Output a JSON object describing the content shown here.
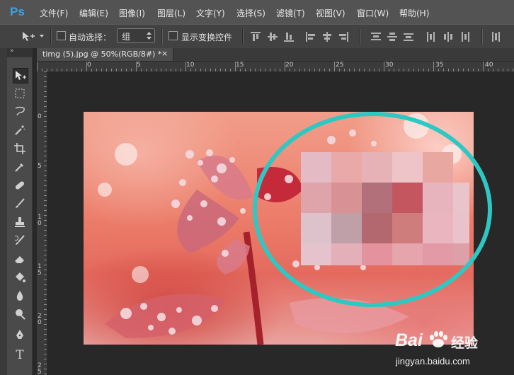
{
  "app": {
    "logo": "Ps"
  },
  "menu": [
    "文件(F)",
    "编辑(E)",
    "图像(I)",
    "图层(L)",
    "文字(Y)",
    "选择(S)",
    "滤镜(T)",
    "视图(V)",
    "窗口(W)",
    "帮助(H)"
  ],
  "options": {
    "auto_select_label": "自动选择：",
    "auto_select_value": "组",
    "show_transform_label": "显示变换控件"
  },
  "document": {
    "tab_title": "timg (5).jpg @ 50%(RGB/8#) *",
    "close_glyph": "×"
  },
  "ruler": {
    "top": [
      "0",
      "5",
      "10",
      "15",
      "20",
      "25",
      "30",
      "35",
      "40"
    ],
    "left": [
      "0",
      "5",
      "1\n0",
      "1\n5",
      "2\n0",
      "2\n5"
    ]
  },
  "toolbar": {
    "tools": [
      "move-tool",
      "marquee-tool",
      "lasso-tool",
      "magic-wand-tool",
      "crop-tool",
      "eyedropper-tool",
      "healing-brush-tool",
      "brush-tool",
      "clone-stamp-tool",
      "history-brush-tool",
      "eraser-tool",
      "paint-bucket-tool",
      "blur-tool",
      "dodge-tool",
      "pen-tool",
      "type-tool"
    ],
    "type_glyph": "T"
  },
  "watermark": {
    "brand": "Bai",
    "brand2": "经验",
    "url": "jingyan.baidu.com"
  },
  "colors": {
    "menubar_bg": "#535353",
    "highlight_circle": "#2ec8c4",
    "ps_blue": "#3aa3e8"
  }
}
